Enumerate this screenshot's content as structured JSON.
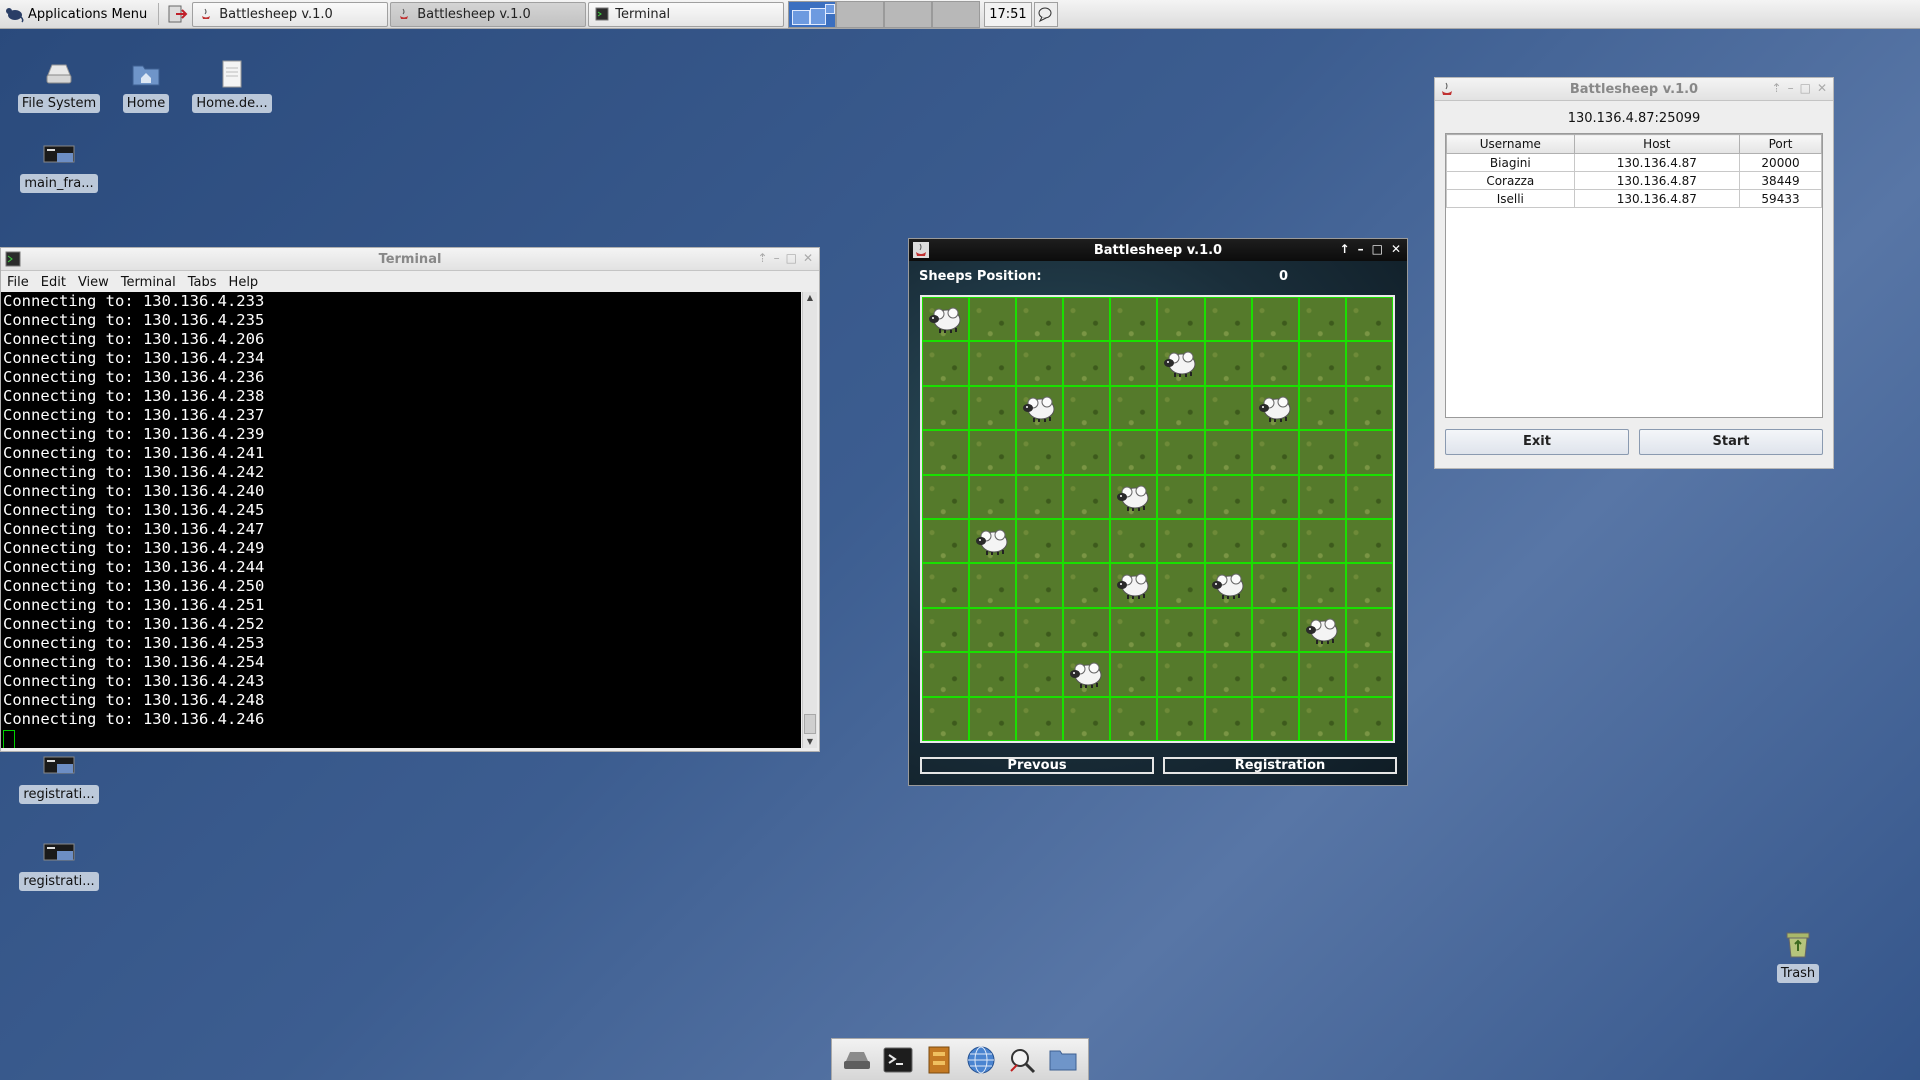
{
  "panel": {
    "apps_menu_label": "Applications Menu",
    "tasks": [
      {
        "label": "Battlesheep v.1.0",
        "active": false
      },
      {
        "label": "Battlesheep v.1.0",
        "active": true
      },
      {
        "label": "Terminal",
        "active": false
      }
    ],
    "clock": "17:51"
  },
  "desktop": {
    "icons": [
      {
        "label": "File System",
        "icon": "drive-icon"
      },
      {
        "label": "Home",
        "icon": "home-folder-icon"
      },
      {
        "label": "Home.de...",
        "icon": "document-icon"
      },
      {
        "label": "main_fra...",
        "icon": "app-window-icon"
      },
      {
        "label": "registrati...",
        "icon": "app-window-icon"
      },
      {
        "label": "registrati...",
        "icon": "app-window-icon"
      },
      {
        "label": "Trash",
        "icon": "trash-icon"
      }
    ]
  },
  "terminal": {
    "title": "Terminal",
    "menu": [
      "File",
      "Edit",
      "View",
      "Terminal",
      "Tabs",
      "Help"
    ],
    "lines": [
      "Connecting to: 130.136.4.233",
      "Connecting to: 130.136.4.235",
      "Connecting to: 130.136.4.206",
      "Connecting to: 130.136.4.234",
      "Connecting to: 130.136.4.236",
      "Connecting to: 130.136.4.238",
      "Connecting to: 130.136.4.237",
      "Connecting to: 130.136.4.239",
      "Connecting to: 130.136.4.241",
      "Connecting to: 130.136.4.242",
      "Connecting to: 130.136.4.240",
      "Connecting to: 130.136.4.245",
      "Connecting to: 130.136.4.247",
      "Connecting to: 130.136.4.249",
      "Connecting to: 130.136.4.244",
      "Connecting to: 130.136.4.250",
      "Connecting to: 130.136.4.251",
      "Connecting to: 130.136.4.252",
      "Connecting to: 130.136.4.253",
      "Connecting to: 130.136.4.254",
      "Connecting to: 130.136.4.243",
      "Connecting to: 130.136.4.248",
      "Connecting to: 130.136.4.246"
    ]
  },
  "game": {
    "title": "Battlesheep v.1.0",
    "position_label": "Sheeps Position:",
    "position_value": "0",
    "grid_size": 10,
    "sheep_cells": [
      [
        0,
        0
      ],
      [
        1,
        5
      ],
      [
        2,
        2
      ],
      [
        2,
        7
      ],
      [
        4,
        4
      ],
      [
        5,
        1
      ],
      [
        6,
        4
      ],
      [
        6,
        6
      ],
      [
        7,
        8
      ],
      [
        8,
        3
      ]
    ],
    "colors": {
      "grid_line": "#19e000",
      "grass": "#557a2b"
    },
    "buttons": {
      "previous": "Prevous",
      "registration": "Registration"
    }
  },
  "lobby": {
    "title": "Battlesheep v.1.0",
    "address": "130.136.4.87:25099",
    "columns": [
      "Username",
      "Host",
      "Port"
    ],
    "rows": [
      [
        "Biagini",
        "130.136.4.87",
        "20000"
      ],
      [
        "Corazza",
        "130.136.4.87",
        "38449"
      ],
      [
        "Iselli",
        "130.136.4.87",
        "59433"
      ]
    ],
    "buttons": {
      "exit": "Exit",
      "start": "Start"
    }
  },
  "dock": {
    "items": [
      "drive-icon",
      "terminal-icon",
      "file-manager-icon",
      "web-browser-icon",
      "app-finder-icon",
      "folder-icon"
    ]
  }
}
